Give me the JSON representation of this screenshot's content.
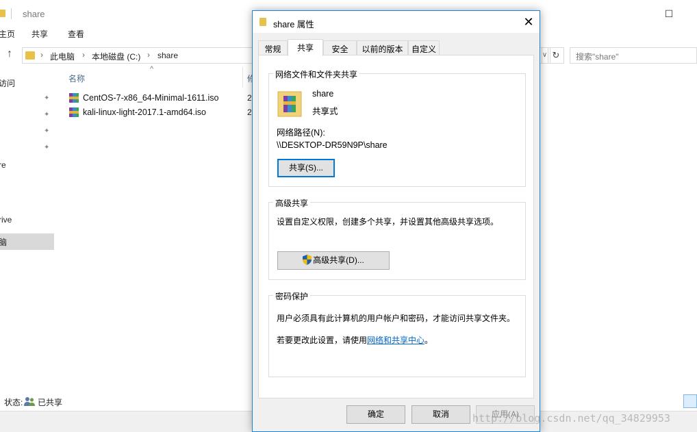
{
  "explorer": {
    "title": "share",
    "ribbon_tabs": [
      "主页",
      "共享",
      "查看"
    ],
    "breadcrumbs": [
      "此电脑",
      "本地磁盘 (C:)",
      "share"
    ],
    "search_placeholder": "搜索\"share\"",
    "nav_items": [
      "访问",
      "re",
      "rive",
      "脑"
    ],
    "column_name": "名称",
    "column_date": "修",
    "files": [
      {
        "name": "CentOS-7-x86_64-Minimal-1611.iso",
        "date": "2"
      },
      {
        "name": "kali-linux-light-2017.1-amd64.iso",
        "date": "2"
      }
    ],
    "status_label": "状态:",
    "status_value": "已共享"
  },
  "dialog": {
    "title": "share 属性",
    "tabs": [
      "常规",
      "共享",
      "安全",
      "以前的版本",
      "自定义"
    ],
    "active_tab": "共享",
    "group_share": {
      "title": "网络文件和文件夹共享",
      "folder_name": "share",
      "share_status": "共享式",
      "network_path_label": "网络路径(N):",
      "network_path": "\\\\DESKTOP-DR59N9P\\share",
      "share_button": "共享(S)..."
    },
    "group_advanced": {
      "title": "高级共享",
      "description": "设置自定义权限，创建多个共享，并设置其他高级共享选项。",
      "button": "高级共享(D)..."
    },
    "group_password": {
      "title": "密码保护",
      "description": "用户必须具有此计算机的用户帐户和密码，才能访问共享文件夹。",
      "line2_prefix": "若要更改此设置，请使用",
      "link": "网络和共享中心",
      "line2_suffix": "。"
    },
    "buttons": {
      "ok": "确定",
      "cancel": "取消",
      "apply": "应用(A)"
    }
  },
  "watermark": "http://blog.csdn.net/qq_34829953",
  "colors": {
    "accent": "#0078d7",
    "link": "#0066cc",
    "folder": "#e8c04a"
  }
}
